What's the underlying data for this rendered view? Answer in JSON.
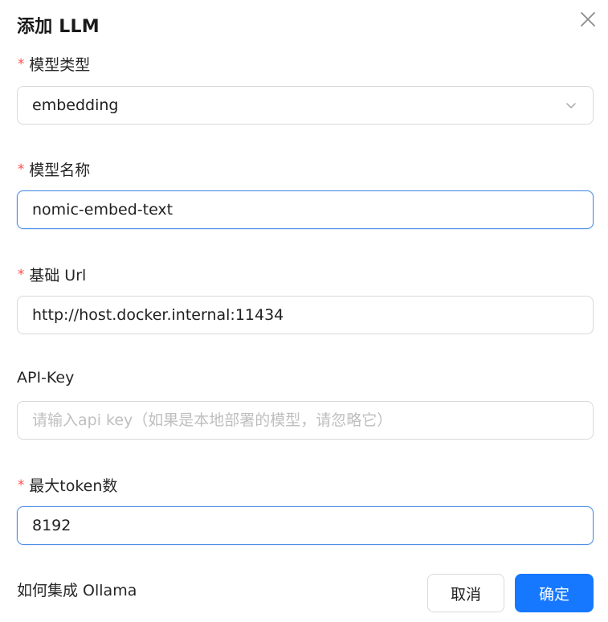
{
  "dialog": {
    "title": "添加 LLM",
    "close_icon": "close-icon"
  },
  "fields": {
    "model_type": {
      "label": "模型类型",
      "required_mark": "*",
      "value": "embedding",
      "icon": "chevron-down-icon"
    },
    "model_name": {
      "label": "模型名称",
      "required_mark": "*",
      "value": "nomic-embed-text"
    },
    "base_url": {
      "label": "基础 Url",
      "required_mark": "*",
      "value": "http://host.docker.internal:11434"
    },
    "api_key": {
      "label": "API-Key",
      "value": "",
      "placeholder": "请输入api key（如果是本地部署的模型，请忽略它）"
    },
    "max_tokens": {
      "label": "最大token数",
      "required_mark": "*",
      "value": "8192"
    }
  },
  "footer": {
    "help_link": "如何集成 Ollama",
    "cancel_label": "取消",
    "ok_label": "确定"
  },
  "colors": {
    "accent": "#1677ff",
    "required": "#ff4d4f",
    "focus_border": "#4e8fe8"
  }
}
